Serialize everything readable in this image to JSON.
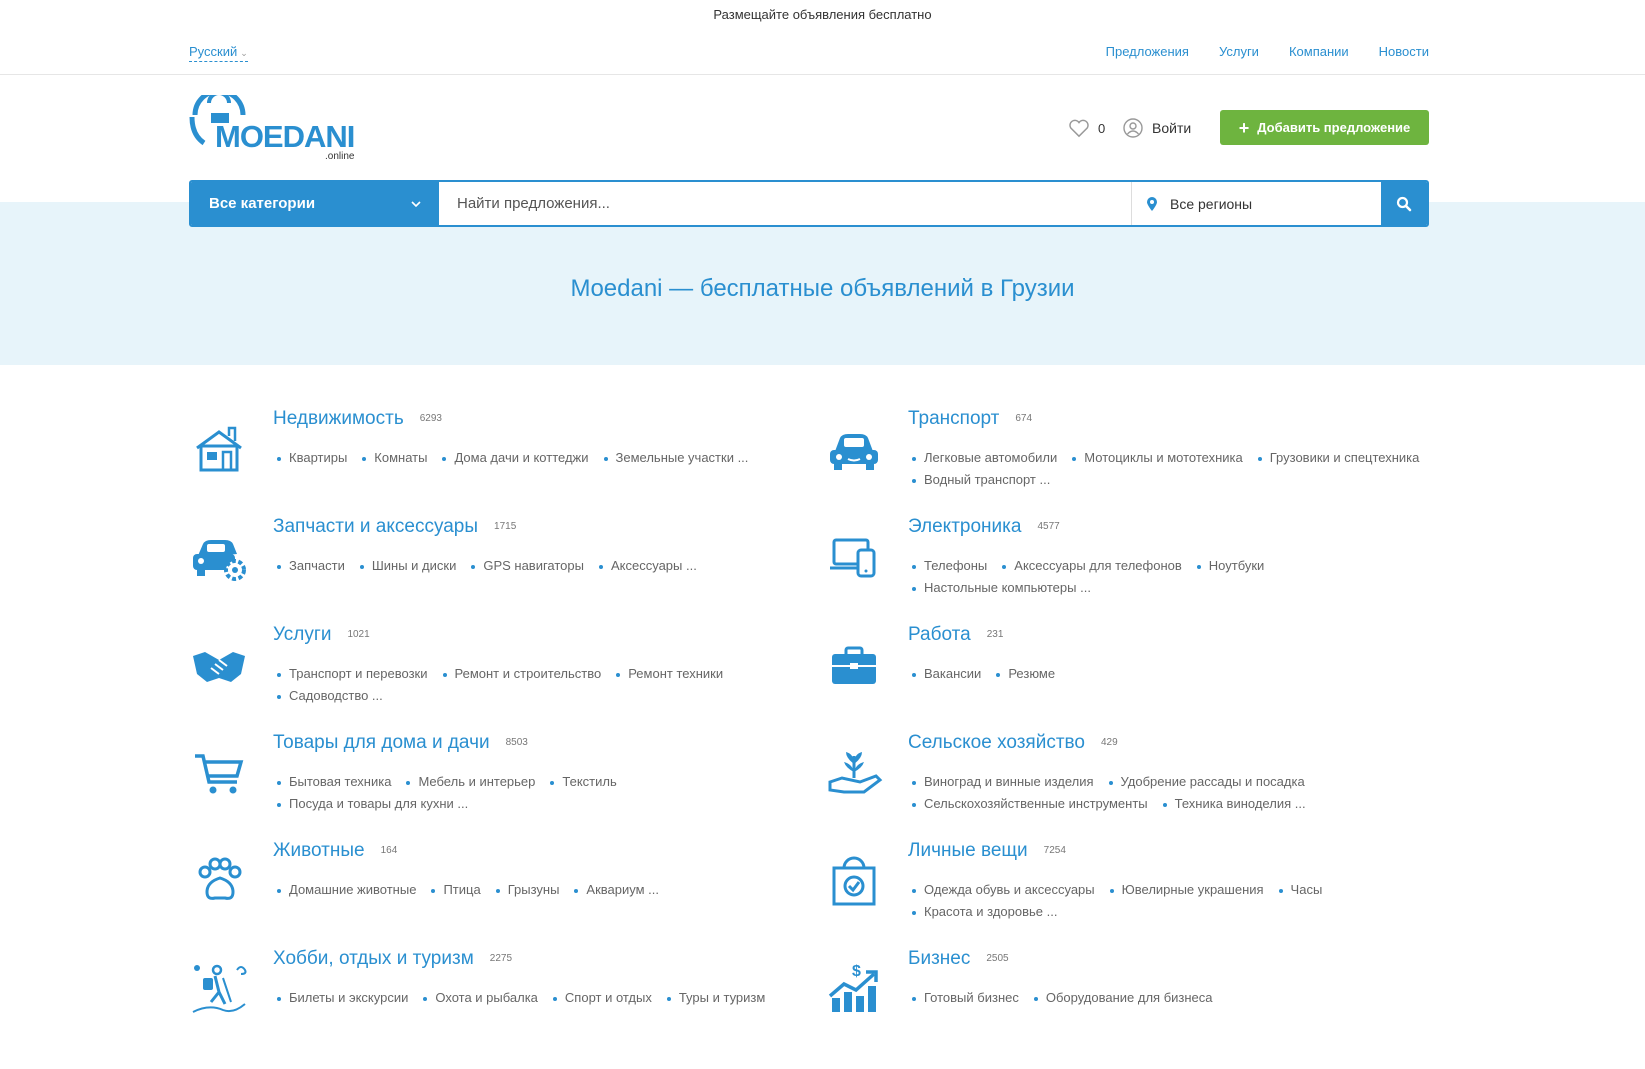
{
  "topbar": {
    "tagline": "Размещайте объявления бесплатно",
    "language": "Русский",
    "nav": [
      "Предложения",
      "Услуги",
      "Компании",
      "Новости"
    ]
  },
  "header": {
    "logo_main": "MOEDANI",
    "logo_sub": ".online",
    "favorites_count": "0",
    "login_label": "Войти",
    "add_button_label": "Добавить предложение",
    "add_button_color": "#6eb43f"
  },
  "search": {
    "category_label": "Все категории",
    "placeholder": "Найти предложения...",
    "region_label": "Все регионы",
    "accent_color": "#2a8fd0"
  },
  "hero": {
    "title": "Moedani — бесплатные объявлений в Грузии"
  },
  "categories": [
    {
      "icon": "house-icon",
      "title": "Недвижимость",
      "count": "6293",
      "subs": [
        "Квартиры",
        "Комнаты",
        "Дома дачи и коттеджи",
        "Земельные участки ..."
      ]
    },
    {
      "icon": "car-icon",
      "title": "Транспорт",
      "count": "674",
      "subs": [
        "Легковые автомобили",
        "Мотоциклы и мототехника",
        "Грузовики и спецтехника",
        "Водный транспорт ..."
      ]
    },
    {
      "icon": "car-gear-icon",
      "title": "Запчасти и аксессуары",
      "count": "1715",
      "subs": [
        "Запчасти",
        "Шины и диски",
        "GPS навигаторы",
        "Аксессуары ..."
      ]
    },
    {
      "icon": "devices-icon",
      "title": "Электроника",
      "count": "4577",
      "subs": [
        "Телефоны",
        "Аксессуары для телефонов",
        "Ноутбуки",
        "Настольные компьютеры ..."
      ]
    },
    {
      "icon": "handshake-icon",
      "title": "Услуги",
      "count": "1021",
      "subs": [
        "Транспорт и перевозки",
        "Ремонт и строительство",
        "Ремонт техники",
        "Садоводство ..."
      ]
    },
    {
      "icon": "briefcase-icon",
      "title": "Работа",
      "count": "231",
      "subs": [
        "Вакансии",
        "Резюме"
      ]
    },
    {
      "icon": "cart-icon",
      "title": "Товары для дома и дачи",
      "count": "8503",
      "subs": [
        "Бытовая техника",
        "Мебель и интерьер",
        "Текстиль",
        "Посуда и товары для кухни ..."
      ]
    },
    {
      "icon": "plant-hand-icon",
      "title": "Сельское хозяйство",
      "count": "429",
      "subs": [
        "Виноград и винные изделия",
        "Удобрение рассады и посадка",
        "Сельскохозяйственные инструменты",
        "Техника виноделия ..."
      ]
    },
    {
      "icon": "paw-icon",
      "title": "Животные",
      "count": "164",
      "subs": [
        "Домашние животные",
        "Птица",
        "Грызуны",
        "Аквариум ..."
      ]
    },
    {
      "icon": "shopping-bag-icon",
      "title": "Личные вещи",
      "count": "7254",
      "subs": [
        "Одежда обувь и аксессуары",
        "Ювелирные украшения",
        "Часы",
        "Красота и здоровье ..."
      ]
    },
    {
      "icon": "hiker-icon",
      "title": "Хобби, отдых и туризм",
      "count": "2275",
      "subs": [
        "Билеты и экскурсии",
        "Охота и рыбалка",
        "Спорт и отдых",
        "Туры и туризм"
      ]
    },
    {
      "icon": "business-growth-icon",
      "title": "Бизнес",
      "count": "2505",
      "subs": [
        "Готовый бизнес",
        "Оборудование для бизнеса"
      ]
    }
  ]
}
